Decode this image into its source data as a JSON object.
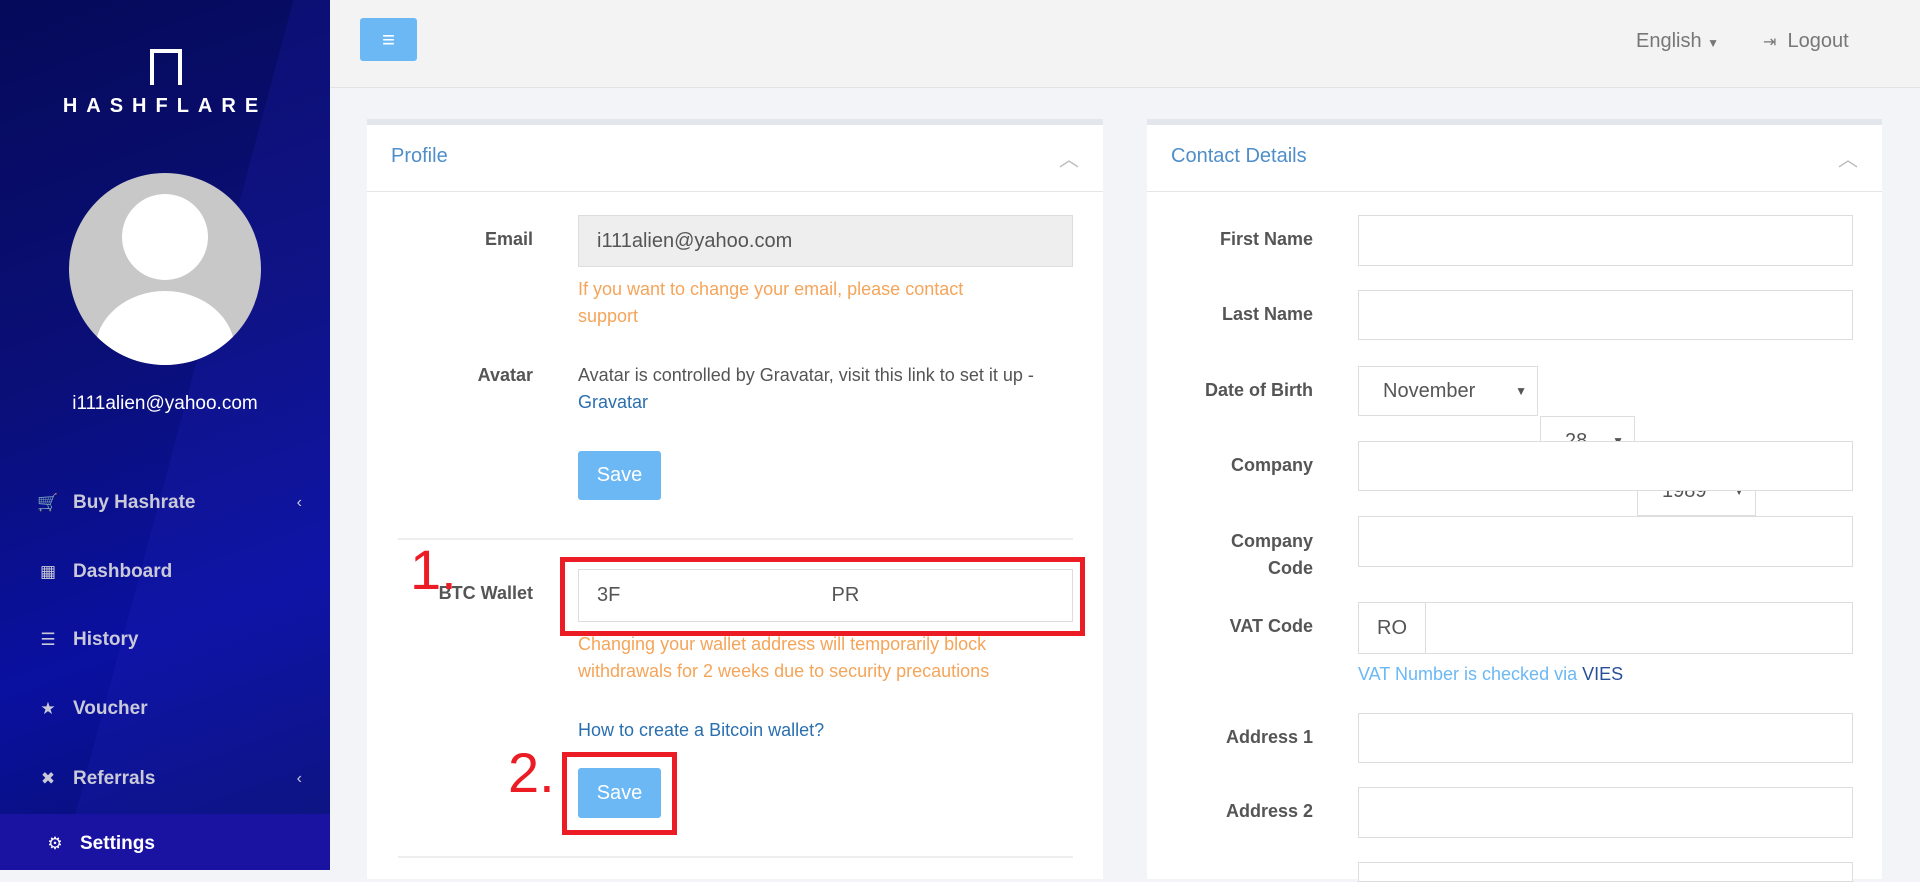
{
  "brand": {
    "name": "HASHFLARE"
  },
  "sidebar": {
    "user_email": "i111alien@yahoo.com",
    "items": [
      {
        "label": "Buy Hashrate",
        "icon": "cart-icon",
        "has_submenu": true
      },
      {
        "label": "Dashboard",
        "icon": "grid-icon",
        "has_submenu": false
      },
      {
        "label": "History",
        "icon": "list-icon",
        "has_submenu": false
      },
      {
        "label": "Voucher",
        "icon": "star-icon",
        "has_submenu": false
      },
      {
        "label": "Referrals",
        "icon": "network-icon",
        "has_submenu": true
      },
      {
        "label": "Settings",
        "icon": "gears-icon",
        "has_submenu": false,
        "active": true
      }
    ]
  },
  "topbar": {
    "language": "English",
    "logout": "Logout"
  },
  "profile": {
    "title": "Profile",
    "email_label": "Email",
    "email_value": "i111alien@yahoo.com",
    "email_help": "If you want to change your email, please contact support",
    "avatar_label": "Avatar",
    "avatar_text": "Avatar is controlled by Gravatar, visit this link to set it up - ",
    "avatar_link": "Gravatar",
    "save": "Save",
    "btc_label": "BTC Wallet",
    "btc_value": "3F                                      PR",
    "btc_help": "Changing your wallet address will temporarily block withdrawals for 2 weeks due to security precautions",
    "howto_link": "How to create a Bitcoin wallet?",
    "save2": "Save"
  },
  "annotations": {
    "step1": "1.",
    "step2": "2.",
    "color": "#ec1c24"
  },
  "contact": {
    "title": "Contact Details",
    "first_name": "First Name",
    "last_name": "Last Name",
    "dob": "Date of Birth",
    "dob_month": "November",
    "dob_day": "28",
    "dob_year": "1989",
    "company": "Company",
    "company_code": "Company Code",
    "vat": "VAT Code",
    "vat_prefix": "RO",
    "vat_note": "VAT Number is checked via ",
    "vat_link": "VIES",
    "address1": "Address 1",
    "address2": "Address 2"
  },
  "colors": {
    "sidebar": "#0a0f78",
    "accent": "#6bb8f5",
    "help": "#f5a55a",
    "panel_title": "#4f8ec9"
  }
}
